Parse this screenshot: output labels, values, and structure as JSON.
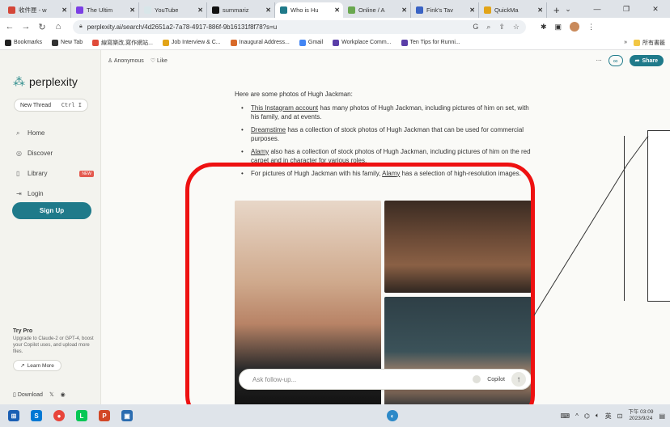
{
  "browser": {
    "tabs": [
      {
        "label": "收件匣 - w",
        "icon": "gmail-icon",
        "color": "#d44638",
        "active": false
      },
      {
        "label": "The Ultim",
        "icon": "chat-icon",
        "color": "#7b3fe4",
        "active": false
      },
      {
        "label": "YouTube",
        "icon": "youtube-icon",
        "color": "#d8e6e9",
        "active": false
      },
      {
        "label": "summariz",
        "icon": "triangle-icon",
        "color": "#111111",
        "active": false
      },
      {
        "label": "Who is Hu",
        "icon": "perplexity-icon",
        "color": "#1f7a8a",
        "active": true
      },
      {
        "label": "Online / A",
        "icon": "bird-icon",
        "color": "#6aa84f",
        "active": false
      },
      {
        "label": "Fink's Tav",
        "icon": "p-icon",
        "color": "#3a63c4",
        "active": false
      },
      {
        "label": "QuickMa",
        "icon": "quickmark-icon",
        "color": "#e2a418",
        "active": false
      }
    ],
    "new_tab_glyph": "+",
    "window_controls": [
      "⌄",
      "—",
      "❐",
      "✕"
    ],
    "url": "perplexity.ai/search/4d2651a2-7a78-4917-886f-9b16131f8f78?s=u",
    "bookmarks": [
      {
        "label": "Bookmarks",
        "color": "#222222"
      },
      {
        "label": "New Tab",
        "color": "#333333"
      },
      {
        "label": "線寫樂改,寫作網站...",
        "color": "#e04b3a"
      },
      {
        "label": "Job Interview & C...",
        "color": "#e2a418"
      },
      {
        "label": "Inaugural Address...",
        "color": "#d86a2a"
      },
      {
        "label": "Gmail",
        "color": "#4285f4"
      },
      {
        "label": "Workplace Comm...",
        "color": "#5a3ea8"
      },
      {
        "label": "Ten Tips for Runni...",
        "color": "#5a3ea8"
      }
    ],
    "bookmarks_more": "»",
    "bookmarks_folder": "所有書籤"
  },
  "sidebar": {
    "logo_text": "perplexity",
    "new_thread_label": "New Thread",
    "new_thread_shortcut": "Ctrl I",
    "nav": [
      {
        "label": "Home",
        "icon": "search-icon",
        "glyph": "⌕"
      },
      {
        "label": "Discover",
        "icon": "compass-icon",
        "glyph": "◎"
      },
      {
        "label": "Library",
        "icon": "library-icon",
        "glyph": "▯",
        "badge": "NEW"
      },
      {
        "label": "Login",
        "icon": "login-icon",
        "glyph": "⇥"
      }
    ],
    "signup_label": "Sign Up",
    "trypro_title": "Try Pro",
    "trypro_desc": "Upgrade to Claude-2 or GPT-4, boost your Copilot uses, and upload more files.",
    "learn_more_label": "Learn More",
    "download_label": "Download"
  },
  "main": {
    "author": "Anonymous",
    "like_label": "Like",
    "share_label": "Share",
    "intro": "Here are some photos of Hugh Jackman:",
    "bullets": [
      {
        "link": "This Instagram account",
        "rest": " has many photos of Hugh Jackman, including pictures of him on set, with his family, and at events."
      },
      {
        "link": "Dreamstime",
        "rest": " has a collection of stock photos of Hugh Jackman that can be used for commercial purposes."
      },
      {
        "link": "Alamy",
        "rest": " also has a collection of stock photos of Hugh Jackman, including pictures of him on the red carpet and in character for various roles."
      },
      {
        "pre": "For pictures of Hugh Jackman with his family, ",
        "link": "Alamy",
        "rest": " has a selection of high-resolution images."
      }
    ],
    "followup_placeholder": "Ask follow-up...",
    "copilot_label": "Copilot"
  },
  "taskbar": {
    "language": "英",
    "time": "下午 03:09",
    "date": "2023/9/24"
  },
  "colors": {
    "accent": "#1f7a8a",
    "annotation": "#ee1111"
  }
}
